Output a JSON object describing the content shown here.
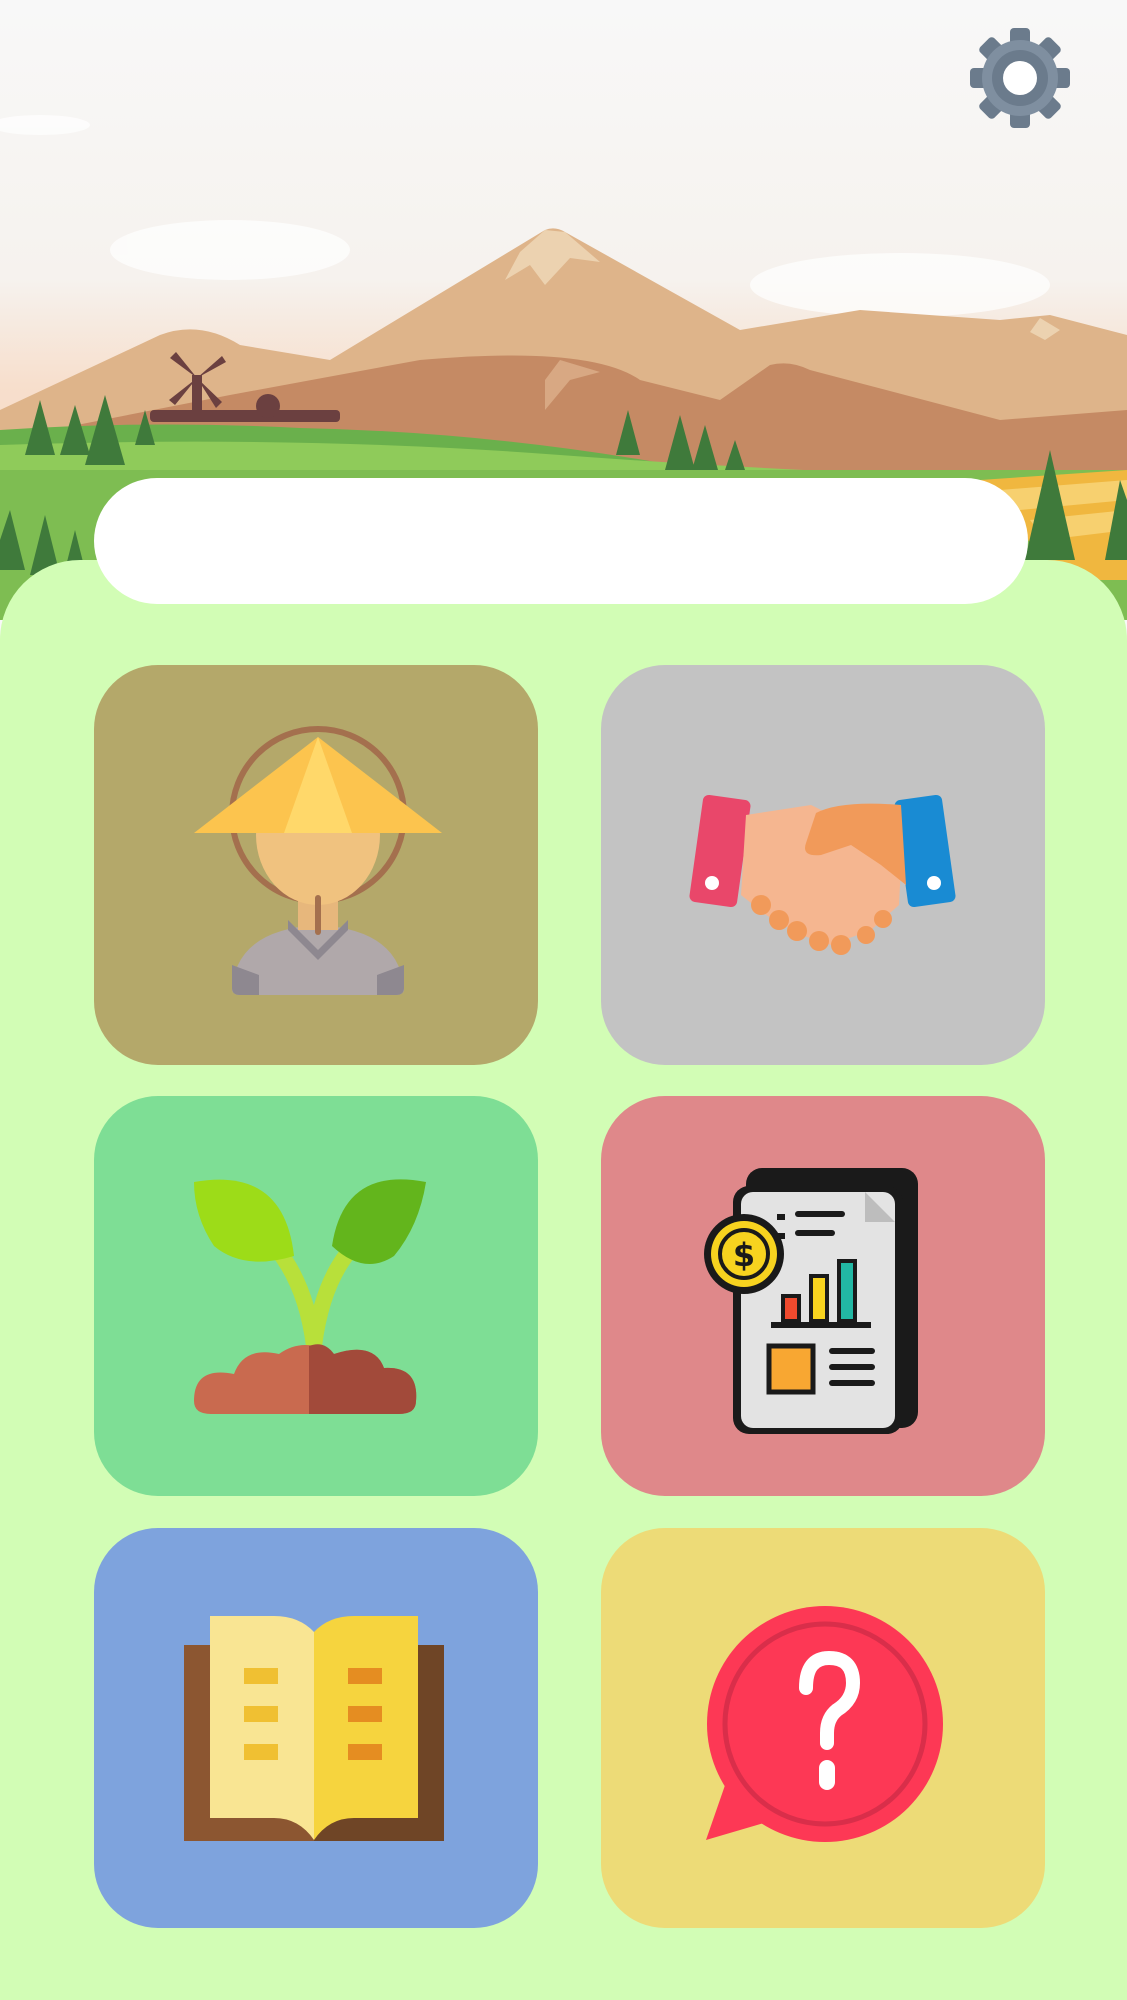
{
  "screen": "home-menu",
  "settings": {
    "icon": "gear-icon"
  },
  "search": {
    "value": ""
  },
  "menu": {
    "tiles": [
      {
        "name": "farmer",
        "icon": "farmer-icon",
        "color": "#b4a86a"
      },
      {
        "name": "partnership",
        "icon": "handshake-icon",
        "color": "#c3c3c3"
      },
      {
        "name": "crops",
        "icon": "sprout-icon",
        "color": "#7ede95"
      },
      {
        "name": "finance-report",
        "icon": "financial-report-icon",
        "color": "#df888a"
      },
      {
        "name": "guide",
        "icon": "open-book-icon",
        "color": "#7ea3dd"
      },
      {
        "name": "help",
        "icon": "question-bubble-icon",
        "color": "#eddb77"
      }
    ]
  },
  "colors": {
    "background": "#f8f8f8",
    "panel": "#d2fdb5",
    "search_bg": "#ffffff"
  }
}
